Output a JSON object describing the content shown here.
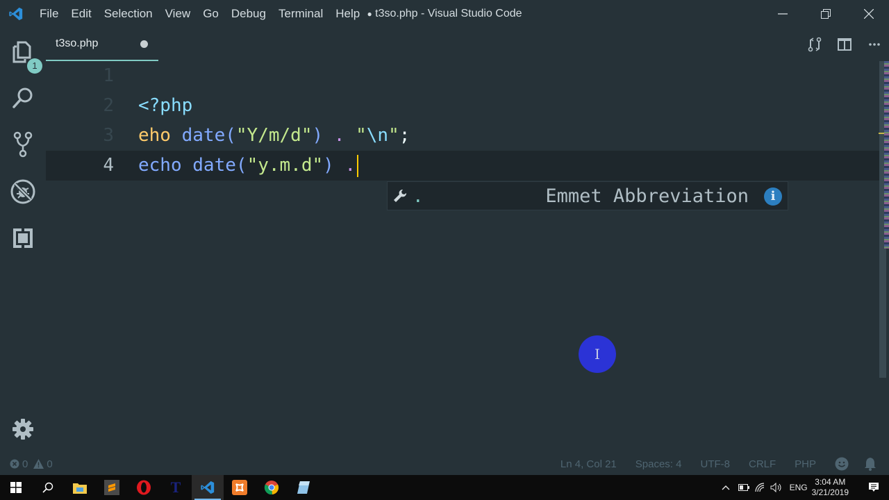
{
  "window": {
    "title": "t3so.php - Visual Studio Code",
    "dirty_indicator": "●",
    "menu": [
      "File",
      "Edit",
      "Selection",
      "View",
      "Go",
      "Debug",
      "Terminal",
      "Help"
    ],
    "controls": {
      "minimize": "minimize-icon",
      "restore": "restore-icon",
      "close": "close-icon"
    }
  },
  "activity_bar": {
    "items": [
      {
        "name": "explorer",
        "icon": "files-icon",
        "badge": "1"
      },
      {
        "name": "search",
        "icon": "search-icon"
      },
      {
        "name": "source-control",
        "icon": "source-control-icon"
      },
      {
        "name": "debug",
        "icon": "debug-icon"
      },
      {
        "name": "extensions",
        "icon": "extensions-icon"
      }
    ],
    "settings_icon": "gear-icon"
  },
  "tabs": [
    {
      "label": "t3so.php",
      "dirty": true,
      "active": true
    }
  ],
  "tab_actions": [
    "open-changes-icon",
    "split-editor-icon",
    "more-actions-icon"
  ],
  "editor": {
    "lines": [
      {
        "number": "1",
        "text": ""
      },
      {
        "number": "2",
        "text": "<?php"
      },
      {
        "number": "3",
        "text": "eho date(\"Y/m/d\") . \"\\n\";"
      },
      {
        "number": "4",
        "text": "echo date(\"y.m.d\") ."
      }
    ],
    "tokens": {
      "l2_open": "<?php",
      "l3_kw": "eho",
      "l3_fn": "date",
      "l3_paren_open": "(",
      "l3_str": "\"Y/m/d\"",
      "l3_paren_close": ")",
      "l3_op": ".",
      "l3_str2_q1": "\"",
      "l3_esc": "\\n",
      "l3_str2_q2": "\"",
      "l3_semi": ";",
      "l4_kw": "echo",
      "l4_fn": "date",
      "l4_paren_open": "(",
      "l4_str": "\"y.m.d\"",
      "l4_paren_close": ")",
      "l4_op": "."
    },
    "current_line": 4,
    "suggestion": {
      "label": ".",
      "detail": "Emmet Abbreviation",
      "kind_icon": "wrench-icon",
      "info_icon": "i"
    },
    "mouse_cursor": "I"
  },
  "status_bar": {
    "errors": "0",
    "warnings": "0",
    "position": "Ln 4, Col 21",
    "indentation": "Spaces: 4",
    "encoding": "UTF-8",
    "eol": "CRLF",
    "language": "PHP"
  },
  "taskbar": {
    "apps": [
      "start",
      "search",
      "file-explorer",
      "sublime-text",
      "opera",
      "notepad-t",
      "vscode",
      "xampp",
      "chrome",
      "notepad-blue"
    ],
    "active_app": "vscode",
    "tray": {
      "language": "ENG",
      "time": "3:04 AM",
      "date": "3/21/2019"
    }
  },
  "colors": {
    "background": "#263238",
    "accent": "#80cbc4",
    "caret": "#ffcc00"
  }
}
